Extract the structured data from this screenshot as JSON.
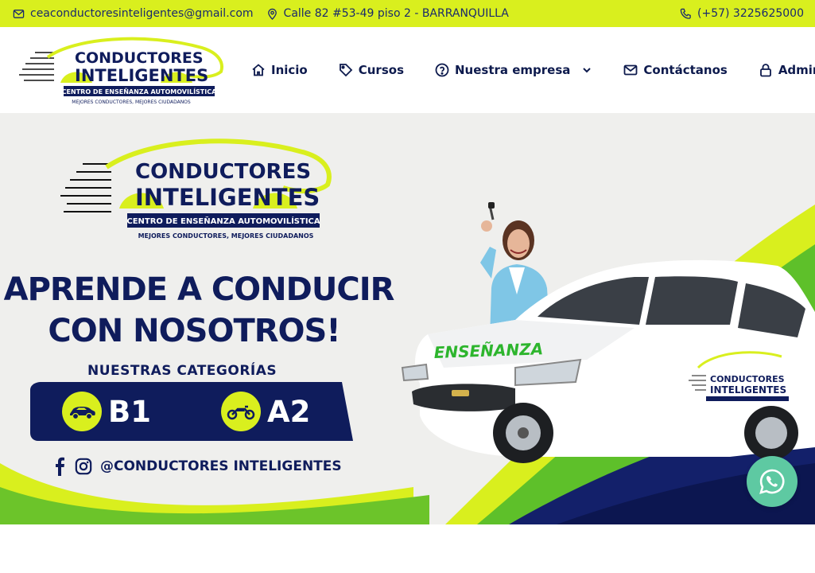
{
  "topbar": {
    "email": "ceaconductoresinteligentes@gmail.com",
    "address": "Calle 82 #53-49 piso 2 - BARRANQUILLA",
    "phone": "(+57) 3225625000",
    "icons": {
      "email": "envelope-icon",
      "address": "map-pin-icon",
      "phone": "phone-icon"
    }
  },
  "logo": {
    "line1": "CONDUCTORES",
    "line2": "INTELIGENTES",
    "band": "CENTRO DE ENSEÑANZA AUTOMOVILÍSTICA",
    "tagline": "MEJORES CONDUCTORES, MEJORES CIUDADANOS"
  },
  "nav": {
    "items": [
      {
        "label": "Inicio",
        "icon": "home-icon"
      },
      {
        "label": "Cursos",
        "icon": "tag-icon"
      },
      {
        "label": "Nuestra empresa",
        "icon": "question-circle-icon",
        "dropdown": true
      },
      {
        "label": "Contáctanos",
        "icon": "envelope-icon"
      },
      {
        "label": "Admin",
        "icon": "lock-icon"
      }
    ]
  },
  "hero": {
    "headline_line1": "APRENDE A CONDUCIR",
    "headline_line2": "CON NOSOTROS!",
    "categories_title": "NUESTRAS CATEGORÍAS",
    "categories": [
      {
        "label": "B1",
        "icon": "car-icon"
      },
      {
        "label": "A2",
        "icon": "motorcycle-icon"
      }
    ],
    "social_handle": "@CONDUCTORES INTELIGENTES",
    "car_door_text": "ENSEÑANZA"
  },
  "colors": {
    "accent_lime": "#d9ef1e",
    "navy": "#0f1c5c",
    "green": "#2db52d",
    "whatsapp": "#5ec9a2"
  },
  "whatsapp_button": {
    "icon": "whatsapp-icon"
  }
}
